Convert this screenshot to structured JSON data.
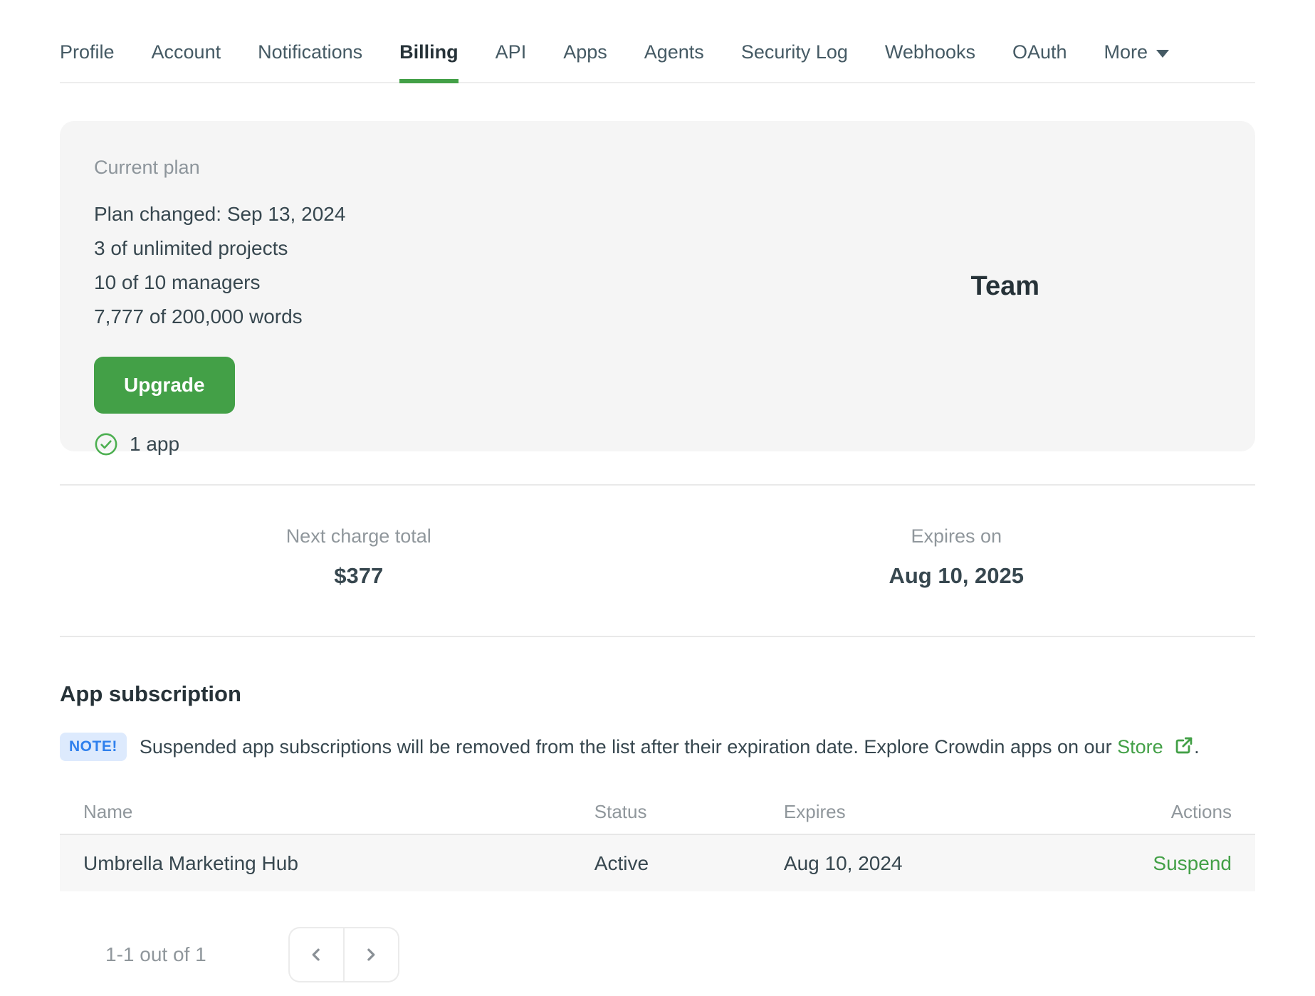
{
  "nav": {
    "tabs": [
      "Profile",
      "Account",
      "Notifications",
      "Billing",
      "API",
      "Apps",
      "Agents",
      "Security Log",
      "Webhooks",
      "OAuth"
    ],
    "more_label": "More",
    "active_tab": "Billing"
  },
  "plan_card": {
    "label": "Current plan",
    "lines": [
      "Plan changed: Sep 13, 2024",
      "3 of unlimited projects",
      "10 of 10 managers",
      "7,777 of 200,000 words"
    ],
    "upgrade_label": "Upgrade",
    "apps_label": "1 app",
    "plan_name": "Team"
  },
  "billing_summary": {
    "columns": [
      {
        "label": "Next charge total",
        "value": "$377"
      },
      {
        "label": "Expires on",
        "value": "Aug 10, 2025"
      }
    ]
  },
  "app_subscription": {
    "title": "App subscription",
    "note_badge": "NOTE!",
    "note_text": "Suspended app subscriptions will be removed from the list after their expiration date. Explore Crowdin apps on our",
    "store_link_label": "Store",
    "note_suffix": ".",
    "table": {
      "headers": [
        "Name",
        "Status",
        "Expires",
        "Actions"
      ],
      "rows": [
        {
          "name": "Umbrella Marketing Hub",
          "status": "Active",
          "expires": "Aug 10, 2024",
          "action": "Suspend"
        }
      ]
    },
    "pagination": {
      "label": "1-1 out of 1"
    }
  },
  "colors": {
    "accent_green": "#43a047",
    "note_badge_bg": "#ddeafd",
    "note_badge_text": "#2f80ed",
    "card_bg": "#f5f5f5",
    "row_bg": "#f7f7f7",
    "text_dark": "#263238",
    "text_body": "#37474f",
    "text_muted": "#90979c"
  }
}
